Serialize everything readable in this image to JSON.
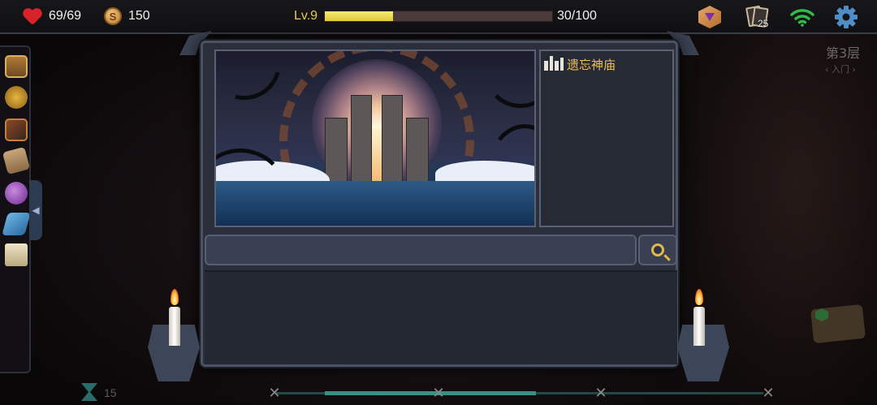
{
  "hud": {
    "hp": "69/69",
    "gold": "150",
    "coin_symbol": "S",
    "level": "Lv.9",
    "xp_text": "30/100",
    "xp_fraction": 0.3,
    "deck_count": "25",
    "icons": [
      "heart-icon",
      "coin-icon",
      "dice-icon",
      "cards-icon",
      "wifi-icon",
      "gear-icon"
    ]
  },
  "floor": {
    "title": "第3层",
    "subtitle": "‹ 入门 ›"
  },
  "location": {
    "name": "遗忘神庙"
  },
  "sidebar": {
    "icons": [
      "treasure-chest-icon",
      "gold-mask-icon",
      "spellbook-icon",
      "parcel-icon",
      "purple-potion-icon",
      "crystal-bar-icon",
      "scroll-icon"
    ],
    "collapse_arrow": "◀"
  },
  "bottom": {
    "turns": "15",
    "marker": "✕"
  },
  "colors": {
    "accent_gold": "#f0c050",
    "xp_bar": "#e1c83a",
    "wifi": "#33b94a",
    "settings": "#4d8ec6",
    "panel": "#2a2f3b"
  }
}
